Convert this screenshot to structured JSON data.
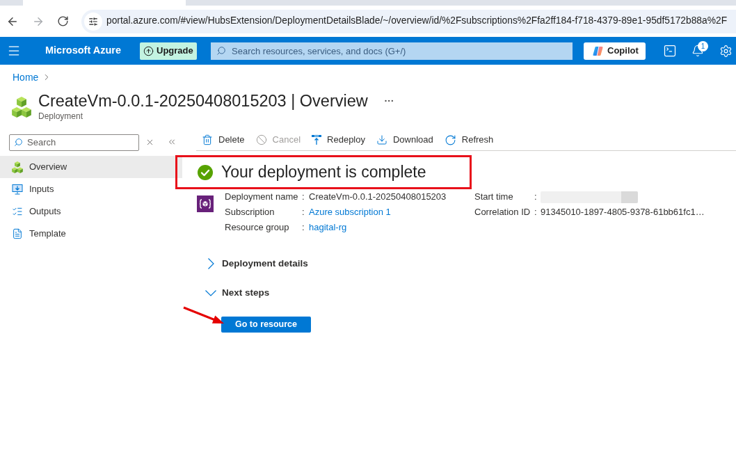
{
  "browser": {
    "url": "portal.azure.com/#view/HubsExtension/DeploymentDetailsBlade/~/overview/id/%2Fsubscriptions%2Ffa2ff184-f718-4379-89e1-95df5172b88a%2F",
    "forward_disabled": true
  },
  "header": {
    "brand": "Microsoft Azure",
    "upgrade_label": "Upgrade",
    "search_placeholder": "Search resources, services, and docs (G+/)",
    "copilot_label": "Copilot",
    "notification_count": "1"
  },
  "breadcrumb": [
    {
      "label": "Home"
    }
  ],
  "page": {
    "title": "CreateVm-0.0.1-20250408015203 | Overview",
    "subtitle": "Deployment"
  },
  "sidebar": {
    "search_placeholder": "Search",
    "items": [
      {
        "label": "Overview",
        "selected": true
      },
      {
        "label": "Inputs",
        "selected": false
      },
      {
        "label": "Outputs",
        "selected": false
      },
      {
        "label": "Template",
        "selected": false
      }
    ]
  },
  "toolbar": [
    {
      "label": "Delete",
      "disabled": false
    },
    {
      "label": "Cancel",
      "disabled": true
    },
    {
      "label": "Redeploy",
      "disabled": false
    },
    {
      "label": "Download",
      "disabled": false
    },
    {
      "label": "Refresh",
      "disabled": false
    }
  ],
  "status": {
    "message": "Your deployment is complete"
  },
  "details": {
    "left": [
      {
        "label": "Deployment name",
        "separator": ":",
        "kind": "text",
        "value": "CreateVm-0.0.1-20250408015203"
      },
      {
        "label": "Subscription",
        "separator": ":",
        "kind": "link",
        "value": "Azure subscription 1"
      },
      {
        "label": "Resource group",
        "separator": ":",
        "kind": "link",
        "value": "hagital-rg"
      }
    ],
    "right": [
      {
        "label": "Start time",
        "separator": ":",
        "kind": "redacted"
      },
      {
        "label": "Correlation ID",
        "separator": ":",
        "kind": "text",
        "value": "91345010-1897-4805-9378-61bb61fc1…"
      }
    ]
  },
  "sections": [
    {
      "label": "Deployment details",
      "expanded": false
    },
    {
      "label": "Next steps",
      "expanded": true
    }
  ],
  "action": {
    "label": "Go to resource"
  }
}
